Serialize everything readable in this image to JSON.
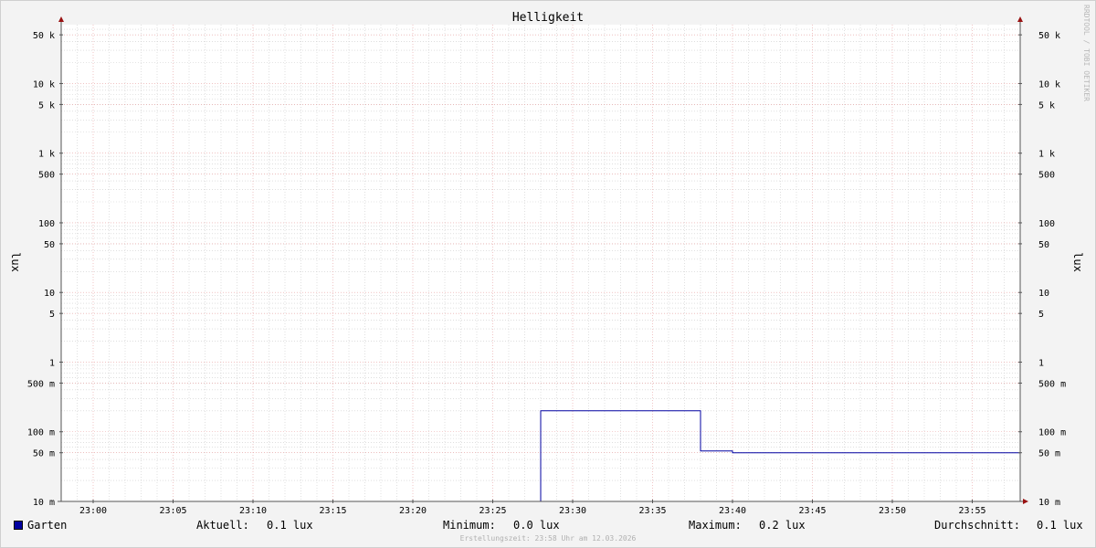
{
  "chart_data": {
    "type": "line",
    "title": "Helligkeit",
    "ylabel": "lux",
    "ylabel_right": "lux",
    "y_scale": "log",
    "ylim": [
      0.01,
      70000
    ],
    "xlim": [
      "22:58",
      "23:58"
    ],
    "x_ticks": [
      "23:00",
      "23:05",
      "23:10",
      "23:15",
      "23:20",
      "23:25",
      "23:30",
      "23:35",
      "23:40",
      "23:45",
      "23:50",
      "23:55"
    ],
    "y_ticks": [
      {
        "value": 50000,
        "label": "50 k"
      },
      {
        "value": 10000,
        "label": "10 k"
      },
      {
        "value": 5000,
        "label": "5 k"
      },
      {
        "value": 1000,
        "label": "1 k"
      },
      {
        "value": 500,
        "label": "500"
      },
      {
        "value": 100,
        "label": "100"
      },
      {
        "value": 50,
        "label": "50"
      },
      {
        "value": 10,
        "label": "10"
      },
      {
        "value": 5,
        "label": "5"
      },
      {
        "value": 1,
        "label": "1"
      },
      {
        "value": 0.5,
        "label": "500 m"
      },
      {
        "value": 0.1,
        "label": "100 m"
      },
      {
        "value": 0.05,
        "label": "50 m"
      },
      {
        "value": 0.01,
        "label": "10 m"
      }
    ],
    "grid": true,
    "series": [
      {
        "name": "Garten",
        "color": "#0000a0",
        "x": [
          "22:58",
          "23:28",
          "23:28",
          "23:38",
          "23:38",
          "23:40",
          "23:40",
          "23:58"
        ],
        "y": [
          0.01,
          0.01,
          0.2,
          0.2,
          0.053,
          0.053,
          0.05,
          0.05
        ]
      }
    ],
    "legend": {
      "swatch_color": "#0000a0",
      "name": "Garten",
      "stats": [
        {
          "label": "Aktuell:",
          "value": "0.1 lux"
        },
        {
          "label": "Minimum:",
          "value": "0.0 lux"
        },
        {
          "label": "Maximum:",
          "value": "0.2 lux"
        },
        {
          "label": "Durchschnitt:",
          "value": "0.1 lux"
        }
      ]
    },
    "credit": "RRDTOOL / TOBI OETIKER",
    "footer": "Erstellungszeit: 23:58 Uhr am 12.03.2026"
  },
  "colors": {
    "background": "#f3f3f3",
    "canvas": "#ffffff",
    "major_grid": "#e8a0a0",
    "minor_grid": "#cccccc",
    "axis": "#555555",
    "arrow": "#991111"
  }
}
